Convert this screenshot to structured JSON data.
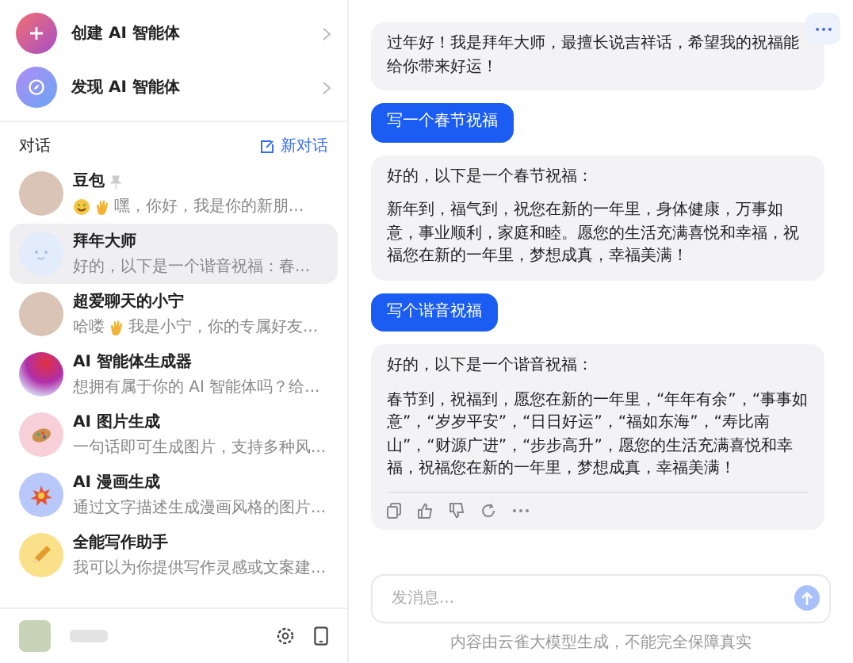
{
  "sidebar": {
    "actions": [
      {
        "kind": "create",
        "label": "创建 AI 智能体"
      },
      {
        "kind": "discover",
        "label": "发现 AI 智能体"
      }
    ],
    "section_title": "对话",
    "new_chat": "新对话",
    "conversations": [
      {
        "kind": "person",
        "title": "豆包",
        "pinned": true,
        "selected": false,
        "preview": [
          {
            "kind": "smile"
          },
          {
            "kind": "wave"
          },
          {
            "kind": "text",
            "text": "嘿，你好，我是你的新朋..."
          }
        ]
      },
      {
        "kind": "face",
        "title": "拜年大师",
        "pinned": false,
        "selected": true,
        "preview": [
          {
            "kind": "text",
            "text": "好的，以下是一个谐音祝福：春..."
          }
        ]
      },
      {
        "kind": "person",
        "title": "超爱聊天的小宁",
        "pinned": false,
        "selected": false,
        "preview": [
          {
            "kind": "text",
            "text": "哈喽"
          },
          {
            "kind": "wave"
          },
          {
            "kind": "text",
            "text": "我是小宁，你的专属好友..."
          }
        ]
      },
      {
        "kind": "gradient",
        "title": "AI 智能体生成器",
        "pinned": false,
        "selected": false,
        "preview": [
          {
            "kind": "text",
            "text": "想拥有属于你的 AI 智能体吗？给..."
          }
        ]
      },
      {
        "kind": "palette",
        "title": "AI 图片生成",
        "pinned": false,
        "selected": false,
        "preview": [
          {
            "kind": "text",
            "text": "一句话即可生成图片，支持多种风..."
          }
        ]
      },
      {
        "kind": "burst",
        "title": "AI 漫画生成",
        "pinned": false,
        "selected": false,
        "preview": [
          {
            "kind": "text",
            "text": "通过文字描述生成漫画风格的图片..."
          }
        ]
      },
      {
        "kind": "pencil",
        "title": "全能写作助手",
        "pinned": false,
        "selected": false,
        "preview": [
          {
            "kind": "text",
            "text": "我可以为你提供写作灵感或文案建..."
          }
        ]
      }
    ]
  },
  "chat": {
    "messages": [
      {
        "kind": "bot",
        "paragraphs": [
          "过年好！我是拜年大师，最擅长说吉祥话，希望我的祝福能给你带来好运！"
        ],
        "actions": false
      },
      {
        "kind": "user",
        "paragraphs": [
          "写一个春节祝福"
        ],
        "actions": false
      },
      {
        "kind": "bot",
        "paragraphs": [
          "好的，以下是一个春节祝福：",
          "新年到，福气到，祝您在新的一年里，身体健康，万事如意，事业顺利，家庭和睦。愿您的生活充满喜悦和幸福，祝福您在新的一年里，梦想成真，幸福美满！"
        ],
        "actions": false
      },
      {
        "kind": "user",
        "paragraphs": [
          "写个谐音祝福"
        ],
        "actions": false
      },
      {
        "kind": "bot",
        "paragraphs": [
          "好的，以下是一个谐音祝福：",
          "春节到，祝福到，愿您在新的一年里，“年年有余”，“事事如意”，“岁岁平安”，“日日好运”，“福如东海”，“寿比南山”，“财源广进”，“步步高升”，愿您的生活充满喜悦和幸福，祝福您在新的一年里，梦想成真，幸福美满！"
        ],
        "actions": true
      }
    ],
    "input": {
      "placeholder": "发消息..."
    },
    "disclaimer": "内容由云雀大模型生成，不能完全保障真实"
  }
}
